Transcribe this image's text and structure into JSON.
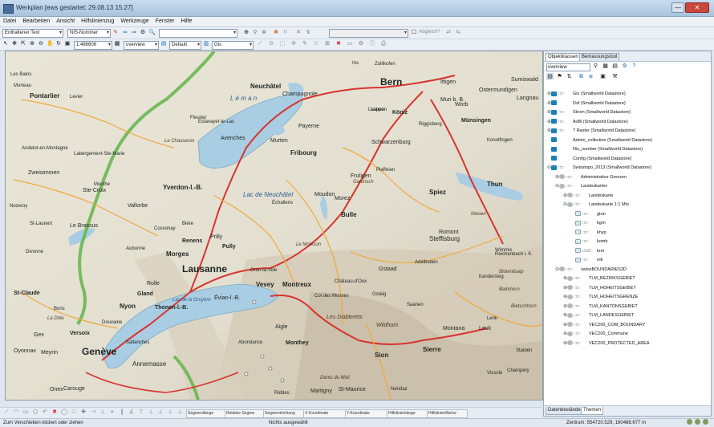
{
  "window": {
    "title": "Werkplan [ews gestartet: 29.08.13 15:27]",
    "min_label": "—",
    "close_label": "✕"
  },
  "menu": [
    "Datei",
    "Bearbeiten",
    "Ansicht",
    "Hilfslinienzug",
    "Werkzeuge",
    "Fenster",
    "Hilfe"
  ],
  "toolbar1": {
    "text_combo": "Enthaltener Text",
    "nis_combo": "NIS-Nummer",
    "search_combo": "",
    "check_label": "Abgleich?"
  },
  "toolbar2": {
    "scale_combo": "1:486606",
    "view_combo": "overview",
    "style_combo": "Default",
    "layer_combo": "Gis"
  },
  "map_labels": [
    {
      "text": "Neuchâtel",
      "cls": "l b"
    },
    {
      "text": "Bern",
      "cls": "xl"
    },
    {
      "text": "Pontarlier",
      "cls": "l b"
    },
    {
      "text": "Fribourg",
      "cls": "l b"
    },
    {
      "text": "Yverdon-l.-B.",
      "cls": "l b"
    },
    {
      "text": "Thun",
      "cls": "l b"
    },
    {
      "text": "Lausanne",
      "cls": "xl"
    },
    {
      "text": "Genève",
      "cls": "xl"
    },
    {
      "text": "Montreux",
      "cls": "l b"
    },
    {
      "text": "Vevey",
      "cls": "l b"
    },
    {
      "text": "Morges",
      "cls": "l b"
    },
    {
      "text": "Nyon",
      "cls": "l b"
    },
    {
      "text": "Annemasse",
      "cls": "l"
    },
    {
      "text": "Bulle",
      "cls": "l b"
    },
    {
      "text": "Sion",
      "cls": "l b"
    },
    {
      "text": "Sierre",
      "cls": "l b"
    },
    {
      "text": "Spiez",
      "cls": "l b"
    },
    {
      "text": "Steffisburg",
      "cls": "l"
    },
    {
      "text": "Zweisimmen",
      "cls": "m"
    },
    {
      "text": "Champagnole",
      "cls": "m"
    },
    {
      "text": "Murten",
      "cls": "m"
    },
    {
      "text": "Payerne",
      "cls": "m"
    },
    {
      "text": "Avenches",
      "cls": "m"
    },
    {
      "text": "Ste-Croix",
      "cls": "m"
    },
    {
      "text": "Vallorbe",
      "cls": "m"
    },
    {
      "text": "Le Brassus",
      "cls": "m"
    },
    {
      "text": "Renens",
      "cls": "m b"
    },
    {
      "text": "Pully",
      "cls": "m b"
    },
    {
      "text": "Prilly",
      "cls": "m"
    },
    {
      "text": "Thonon-l.-B.",
      "cls": "m b"
    },
    {
      "text": "Évian-l.-B.",
      "cls": "m"
    },
    {
      "text": "Monthey",
      "cls": "m b"
    },
    {
      "text": "Aigle",
      "cls": "m"
    },
    {
      "text": "Martigny",
      "cls": "m"
    },
    {
      "text": "Carouge",
      "cls": "m"
    },
    {
      "text": "Versoix",
      "cls": "m b"
    },
    {
      "text": "Gland",
      "cls": "m b"
    },
    {
      "text": "Rolle",
      "cls": "m"
    },
    {
      "text": "St-Claude",
      "cls": "m b"
    },
    {
      "text": "Gex",
      "cls": "m"
    },
    {
      "text": "Oyonnax",
      "cls": "m"
    },
    {
      "text": "Meyrin",
      "cls": "m"
    },
    {
      "text": "Onex",
      "cls": "m"
    },
    {
      "text": "Köniz",
      "cls": "m b"
    },
    {
      "text": "Münsingen",
      "cls": "m b"
    },
    {
      "text": "Worb",
      "cls": "m"
    },
    {
      "text": "Muri b. B.",
      "cls": "m"
    },
    {
      "text": "Ittigen",
      "cls": "m"
    },
    {
      "text": "Ostermundigen",
      "cls": "m"
    },
    {
      "text": "Gstaad",
      "cls": "m"
    },
    {
      "text": "Adelboden",
      "cls": "s"
    },
    {
      "text": "Leuk",
      "cls": "m"
    },
    {
      "text": "Montana",
      "cls": "m"
    },
    {
      "text": "Wildhorn",
      "cls": "m mtn"
    },
    {
      "text": "Les Diablerets",
      "cls": "m mtn"
    },
    {
      "text": "Le Moléson",
      "cls": "s mtn"
    },
    {
      "text": "Schwarzenburg",
      "cls": "m"
    },
    {
      "text": "Riggisberg",
      "cls": "s"
    },
    {
      "text": "Frutigen",
      "cls": "m"
    },
    {
      "text": "Romont",
      "cls": "m"
    },
    {
      "text": "Moudon",
      "cls": "m"
    },
    {
      "text": "Échallens",
      "cls": "s"
    },
    {
      "text": "Lac de Neuchâtel",
      "cls": "l lake"
    },
    {
      "text": "L é m a n",
      "cls": "l lake"
    },
    {
      "text": "Lac de la Gruyère",
      "cls": "s lake"
    },
    {
      "text": "Morez",
      "cls": "m"
    },
    {
      "text": "Divonne",
      "cls": "s"
    },
    {
      "text": "Bons",
      "cls": "s"
    },
    {
      "text": "Sallanches",
      "cls": "s"
    },
    {
      "text": "Champéry",
      "cls": "s"
    },
    {
      "text": "St-Maurice",
      "cls": "m"
    },
    {
      "text": "Dents du Midi",
      "cls": "s mtn"
    },
    {
      "text": "Riddes",
      "cls": "s"
    },
    {
      "text": "Nendaz",
      "cls": "s"
    },
    {
      "text": "Vissoie",
      "cls": "s"
    },
    {
      "text": "St. Niklaus",
      "cls": "s"
    },
    {
      "text": "Saanen",
      "cls": "s"
    },
    {
      "text": "Château-d'Oex",
      "cls": "s"
    },
    {
      "text": "Col des Mosses",
      "cls": "s"
    },
    {
      "text": "Gsteig",
      "cls": "s"
    },
    {
      "text": "Lenk",
      "cls": "s"
    },
    {
      "text": "Kandersteg",
      "cls": "s"
    },
    {
      "text": "Reichenbach i. K.",
      "cls": "s"
    },
    {
      "text": "Wimmis",
      "cls": "s"
    },
    {
      "text": "Plaffeien",
      "cls": "s"
    },
    {
      "text": "Sumiswald",
      "cls": "m"
    },
    {
      "text": "Langnau",
      "cls": "m"
    },
    {
      "text": "Konolfingen",
      "cls": "s"
    },
    {
      "text": "Laupen",
      "cls": "s"
    },
    {
      "text": "Ins",
      "cls": "s"
    },
    {
      "text": "Estavayer-le-Lac",
      "cls": "s"
    },
    {
      "text": "Fleurier",
      "cls": "s"
    },
    {
      "text": "Morteau",
      "cls": "s"
    },
    {
      "text": "Les Bains",
      "cls": "s"
    },
    {
      "text": "Levier",
      "cls": "s"
    },
    {
      "text": "Andelot-en-Montagne",
      "cls": "s"
    },
    {
      "text": "Labergement-Ste-Marie",
      "cls": "s"
    },
    {
      "text": "Mouthe",
      "cls": "s"
    },
    {
      "text": "Nozeroy",
      "cls": "s"
    },
    {
      "text": "St-Laurent",
      "cls": "s"
    },
    {
      "text": "Chamonix",
      "cls": "s"
    },
    {
      "text": "Abondance",
      "cls": "s"
    },
    {
      "text": "Douvaine",
      "cls": "s"
    },
    {
      "text": "Cossonay",
      "cls": "s"
    },
    {
      "text": "Aubonne",
      "cls": "s"
    },
    {
      "text": "Oron-la-Ville",
      "cls": "s"
    },
    {
      "text": "Laupen",
      "cls": "s"
    },
    {
      "text": "Gantrisch",
      "cls": "s mtn"
    },
    {
      "text": "Niesen",
      "cls": "s mtn"
    },
    {
      "text": "Balmhorn",
      "cls": "s mtn"
    },
    {
      "text": "Bietschhorn",
      "cls": "s mtn"
    },
    {
      "text": "Blüemlisalp",
      "cls": "s mtn"
    },
    {
      "text": "Stalden",
      "cls": "s"
    },
    {
      "text": "Zollikofen",
      "cls": "s"
    },
    {
      "text": "Le Chasseron",
      "cls": "s mtn"
    },
    {
      "text": "La Dôle",
      "cls": "s mtn"
    },
    {
      "text": "Bière",
      "cls": "s"
    }
  ],
  "panel": {
    "tabs": [
      "Objektklassen",
      "Bemassungstool"
    ],
    "view_combo": "overview",
    "tree": [
      {
        "depth": 0,
        "twisty": "⊕",
        "kind": "ds",
        "vis": "□□□",
        "label": "Gis (Smallworld Datastore)"
      },
      {
        "depth": 0,
        "twisty": "⊕",
        "kind": "ds",
        "vis": "",
        "label": "Dsf (Smallworld Datastore)"
      },
      {
        "depth": 0,
        "twisty": "⊕",
        "kind": "ds",
        "vis": "□□□",
        "label": "Strom (Smallworld Datastore)"
      },
      {
        "depth": 0,
        "twisty": "⊕",
        "kind": "ds",
        "vis": "□□□",
        "label": "AvBl (Smallworld Datastore)"
      },
      {
        "depth": 0,
        "twisty": "⊕",
        "kind": "ds",
        "vis": "□□□",
        "label": "? Raster (Smallworld Datastore)"
      },
      {
        "depth": 0,
        "twisty": "",
        "kind": "ds",
        "vis": "",
        "label": "Admin_collection (Smallworld Datastore)"
      },
      {
        "depth": 0,
        "twisty": "",
        "kind": "ds",
        "vis": "",
        "label": "Nis_number (Smallworld Datastore)"
      },
      {
        "depth": 0,
        "twisty": "",
        "kind": "ds",
        "vis": "",
        "label": "Config (Smallworld Datastore)"
      },
      {
        "depth": 0,
        "twisty": "⊖",
        "kind": "ds",
        "vis": "□□□",
        "label": "Swisstopo_2013 (Smallworld Datastore)"
      },
      {
        "depth": 1,
        "twisty": "⊕",
        "kind": "grp",
        "vis": "□□□",
        "label": "Administrative Grenzen"
      },
      {
        "depth": 1,
        "twisty": "⊖",
        "kind": "grp",
        "vis": "□□□",
        "label": "Landeskarten"
      },
      {
        "depth": 2,
        "twisty": "⊕",
        "kind": "grp",
        "vis": "□□□",
        "label": "Landeskarte"
      },
      {
        "depth": 2,
        "twisty": "⊖",
        "kind": "grp",
        "vis": "□□□",
        "label": "Landeskarte 1:1 Mio"
      },
      {
        "depth": 3,
        "twisty": "",
        "kind": "leaf",
        "vis": "□□□",
        "label": "gton"
      },
      {
        "depth": 3,
        "twisty": "",
        "kind": "leaf",
        "vis": "□□□",
        "label": "kgrn"
      },
      {
        "depth": 3,
        "twisty": "",
        "kind": "leaf",
        "vis": "□□□",
        "label": "khyp"
      },
      {
        "depth": 3,
        "twisty": "",
        "kind": "leaf",
        "vis": "□□□",
        "label": "komb"
      },
      {
        "depth": 3,
        "twisty": "",
        "kind": "leaf",
        "vis": "☑☑☑",
        "label": "krel"
      },
      {
        "depth": 3,
        "twisty": "",
        "kind": "leaf",
        "vis": "□□□",
        "label": "reli"
      },
      {
        "depth": 1,
        "twisty": "⊖",
        "kind": "grp",
        "vis": "□□□",
        "label": "swissBOUNDARIES3D"
      },
      {
        "depth": 2,
        "twisty": "⊕",
        "kind": "grp",
        "vis": "□□□",
        "label": "TLM_BEZIRKSGEBIET"
      },
      {
        "depth": 2,
        "twisty": "⊕",
        "kind": "grp",
        "vis": "□□□",
        "label": "TLM_HOHEITSGEBIET"
      },
      {
        "depth": 2,
        "twisty": "⊕",
        "kind": "grp",
        "vis": "□□□",
        "label": "TLM_HOHEITSGRENZE"
      },
      {
        "depth": 2,
        "twisty": "⊕",
        "kind": "grp",
        "vis": "□□□",
        "label": "TLM_KANTONSGEBIET"
      },
      {
        "depth": 2,
        "twisty": "⊕",
        "kind": "grp",
        "vis": "□□□",
        "label": "TLM_LANDESGEBIET"
      },
      {
        "depth": 2,
        "twisty": "⊕",
        "kind": "grp",
        "vis": "□□□",
        "label": "VEC200_COM_BOUNDARY"
      },
      {
        "depth": 2,
        "twisty": "⊕",
        "kind": "grp",
        "vis": "□□□",
        "label": "VEC200_Commune"
      },
      {
        "depth": 2,
        "twisty": "⊕",
        "kind": "grp",
        "vis": "□□□",
        "label": "VEC200_PROTECTED_AREA"
      }
    ],
    "bottom_tabs": [
      "Datenbestände",
      "Themen"
    ]
  },
  "status_fields": [
    "Segmentlänge",
    "Relative Segme",
    "Segmentrichtung",
    "X-Koordinate",
    "Y-Koordinate",
    "Hilfslinienlänge",
    "Hilfslinienfläche"
  ],
  "status": {
    "left": "Zum Verschieben klicken oder ziehen",
    "middle": "Nichts ausgewählt",
    "right": "Zentrum: 554720.529, 160488.677 m"
  },
  "colors": {
    "lake": "#a9cde3",
    "road_major": "#d8342e",
    "road_minor": "#f2a73a",
    "green_border": "#63b44a",
    "terrain_high": "#c9c0b0"
  },
  "icons": [
    "magnifier-icon",
    "zoom-in-icon",
    "zoom-out-icon",
    "pan-icon",
    "arrow-icon",
    "refresh-icon",
    "ruler-icon",
    "layer-icon",
    "save-icon",
    "print-icon"
  ]
}
